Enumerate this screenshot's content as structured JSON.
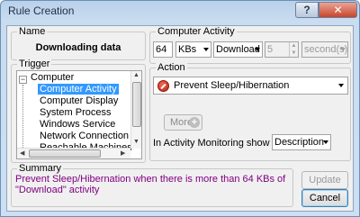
{
  "window": {
    "title": "Rule Creation",
    "help_label": "?",
    "close_label": "✕"
  },
  "name": {
    "label": "Name",
    "value": "Downloading data"
  },
  "trigger": {
    "label": "Trigger",
    "tree": {
      "root": "Computer",
      "items": [
        "Computer Activity",
        "Computer Display",
        "System Process",
        "Windows Service",
        "Network Connection",
        "Reachable Machines"
      ],
      "selected_index": 0
    }
  },
  "activity": {
    "label": "Computer Activity",
    "amount": "64",
    "unit": "KBs",
    "direction": "Download",
    "duration": "5",
    "duration_unit": "second(s)"
  },
  "action": {
    "label": "Action",
    "selected": "Prevent Sleep/Hibernation",
    "more_label": "More",
    "show_label": "In Activity Monitoring show",
    "show_value": "Description"
  },
  "summary": {
    "label": "Summary",
    "text": "Prevent Sleep/Hibernation when there is more than 64 KBs of \"Download\" activity"
  },
  "buttons": {
    "update": "Update",
    "cancel": "Cancel"
  },
  "colors": {
    "summary_text": "#800080",
    "selection": "#3399ff"
  }
}
